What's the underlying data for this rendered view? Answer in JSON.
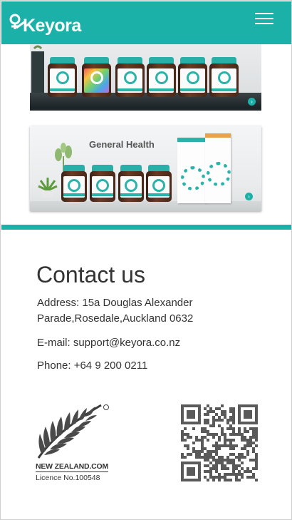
{
  "header": {
    "brand": "Keyora",
    "menu_icon": "hamburger-menu-icon",
    "background_color": "#1bb1a9"
  },
  "banners": [
    {
      "id": "products-shelf",
      "bottle_count": 6
    },
    {
      "id": "general-health",
      "title": "General Health",
      "bottle_count": 4
    }
  ],
  "contact": {
    "title": "Contact us",
    "address_line1": "Address: 15a Douglas Alexander",
    "address_line2": "Parade,Rosedale,Auckland 0632",
    "email": "E-mail: support@keyora.co.nz",
    "phone": "Phone: +64 9 200 0211"
  },
  "footer": {
    "nz_logo_text": "NEW ZEALAND.COM",
    "licence": "Licence No.100548",
    "qr_icon": "qr-code-icon"
  },
  "colors": {
    "accent": "#1bb1a9",
    "text": "#333333"
  }
}
